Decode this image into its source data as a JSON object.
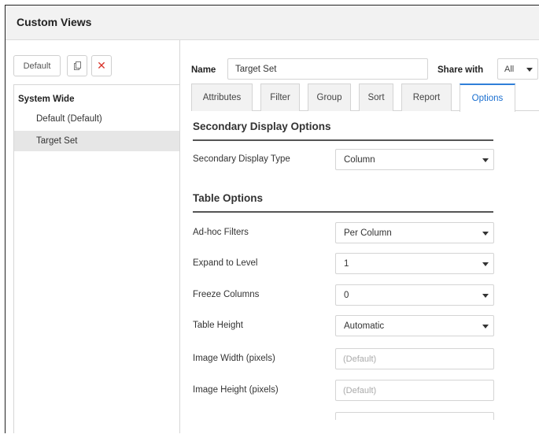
{
  "window": {
    "title": "Custom Views"
  },
  "toolbar": {
    "default_label": "Default",
    "delete_glyph": "✕"
  },
  "tree": {
    "group_label": "System Wide",
    "items": [
      {
        "label": "Default (Default)",
        "selected": false
      },
      {
        "label": "Target Set",
        "selected": true
      }
    ]
  },
  "header": {
    "name_label": "Name",
    "name_value": "Target Set",
    "share_label": "Share with",
    "share_value": "All"
  },
  "tabs": [
    {
      "label": "Attributes"
    },
    {
      "label": "Filter"
    },
    {
      "label": "Group"
    },
    {
      "label": "Sort"
    },
    {
      "label": "Report"
    },
    {
      "label": "Options",
      "active": true
    }
  ],
  "secondary": {
    "title": "Secondary Display Options",
    "type_label": "Secondary Display Type",
    "type_value": "Column"
  },
  "table": {
    "title": "Table Options",
    "adhoc_label": "Ad-hoc Filters",
    "adhoc_value": "Per Column",
    "expand_label": "Expand to Level",
    "expand_value": "1",
    "freeze_label": "Freeze Columns",
    "freeze_value": "0",
    "height_label": "Table Height",
    "height_value": "Automatic",
    "img_width_label": "Image Width (pixels)",
    "img_width_placeholder": "(Default)",
    "img_height_label": "Image Height (pixels)",
    "img_height_placeholder": "(Default)"
  },
  "colors": {
    "accent": "#2f7fd8",
    "delete": "#d9342b",
    "selected_row": "#e6e6e6"
  }
}
